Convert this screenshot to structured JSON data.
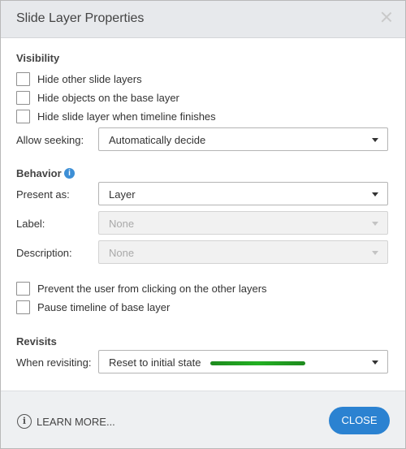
{
  "dialog": {
    "title": "Slide Layer Properties",
    "close_icon": "close-icon"
  },
  "visibility": {
    "heading": "Visibility",
    "checkboxes": [
      {
        "label": "Hide other slide layers",
        "checked": false
      },
      {
        "label": "Hide objects on the base layer",
        "checked": false
      },
      {
        "label": "Hide slide layer when timeline finishes",
        "checked": false
      }
    ],
    "seeking_label": "Allow seeking:",
    "seeking_value": "Automatically decide"
  },
  "behavior": {
    "heading": "Behavior",
    "info_icon": "info-icon",
    "present_label": "Present as:",
    "present_value": "Layer",
    "label_label": "Label:",
    "label_value": "None",
    "description_label": "Description:",
    "description_value": "None",
    "checkboxes": [
      {
        "label": "Prevent the user from clicking on the other layers",
        "checked": false
      },
      {
        "label": "Pause timeline of base layer",
        "checked": false
      }
    ]
  },
  "revisits": {
    "heading": "Revisits",
    "when_label": "When revisiting:",
    "when_value": "Reset to initial state",
    "highlight_color": "#22b022"
  },
  "footer": {
    "learn_more": "LEARN MORE...",
    "close": "CLOSE",
    "accent_color": "#2b82d1"
  }
}
